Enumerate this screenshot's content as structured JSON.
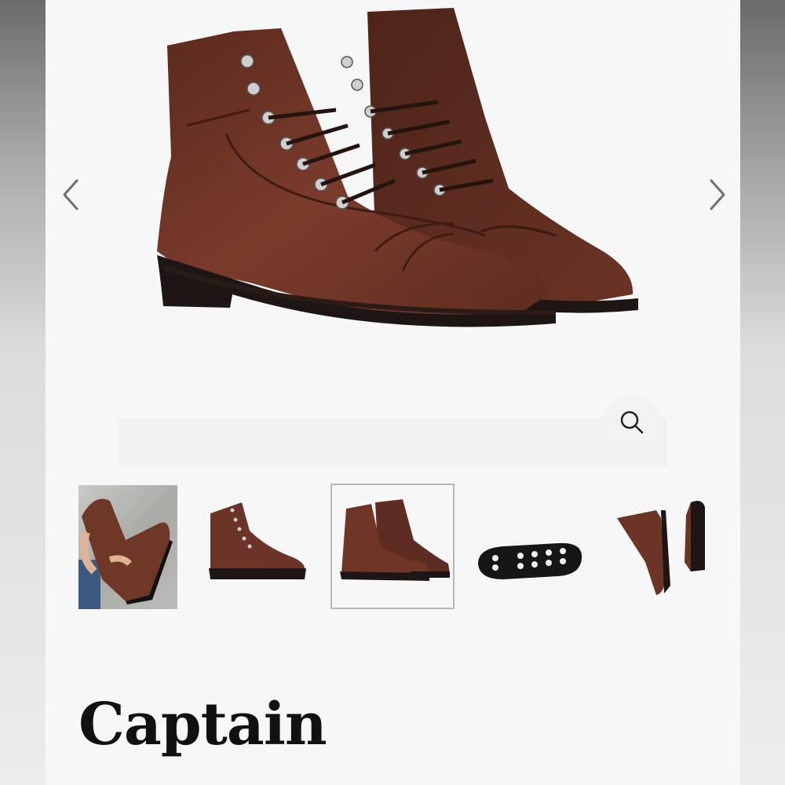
{
  "product": {
    "title": "Captain"
  },
  "carousel": {
    "prev_icon": "chevron-left-icon",
    "next_icon": "chevron-right-icon",
    "zoom_icon": "search-icon",
    "selected_index": 2,
    "thumbnail_count": 5
  },
  "colors": {
    "leather": "#6b3426",
    "sole": "#1e1614",
    "selected_border": "#b8b8b8"
  }
}
